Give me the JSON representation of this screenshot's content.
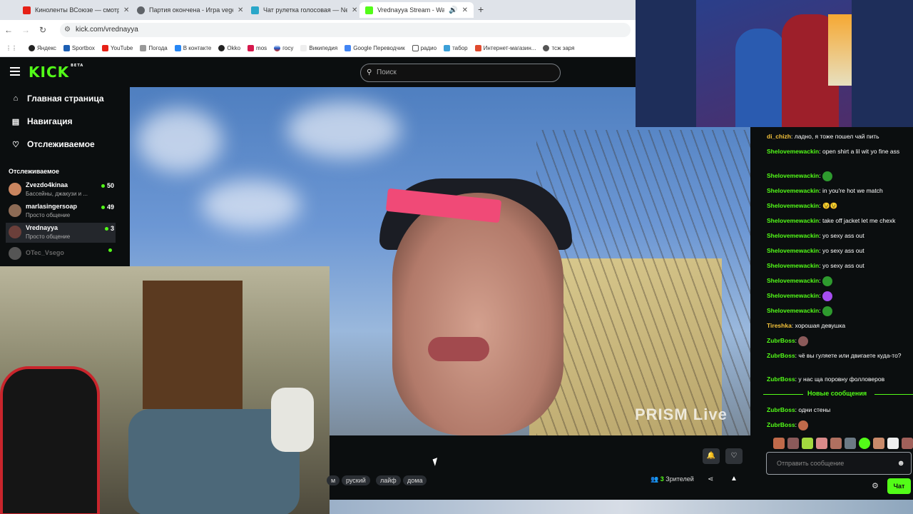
{
  "browser": {
    "tabs": [
      {
        "title": "Киноленты ВСоюзе — смотре",
        "favicon_color": "#e62117"
      },
      {
        "title": "Партия окончена - Игра vege",
        "favicon_color": "#5f6368"
      },
      {
        "title": "Чат рулетка голосовая — Neko",
        "favicon_color": "#2aa7c9"
      },
      {
        "title": "Vrednayya Stream - Watch",
        "favicon_color": "#53fc18"
      }
    ],
    "url": "kick.com/vrednayya",
    "bookmarks": [
      "Яндекс",
      "Sportbox",
      "YouTube",
      "Погода",
      "В контакте",
      "Okko",
      "mos",
      "госу",
      "Википедия",
      "Google Переводчик",
      "радио",
      "табор",
      "Интернет-магазин...",
      "тсж заря"
    ]
  },
  "kick": {
    "logo": "KICK",
    "logo_sup": "BETA",
    "search_placeholder": "Поиск",
    "nav": [
      "Главная страница",
      "Навигация",
      "Отслеживаемое"
    ],
    "following_title": "Отслеживаемое",
    "channels": [
      {
        "name": "Zvezdo4kinaa",
        "category": "Бассейны, джакузи и ...",
        "viewers": "50",
        "avatar_color": "#c9855f"
      },
      {
        "name": "marlasingersoap",
        "category": "Просто общение",
        "viewers": "49",
        "avatar_color": "#8d6b55"
      },
      {
        "name": "Vrednayya",
        "category": "Просто общение",
        "viewers": "3",
        "avatar_color": "#6b3f3a"
      },
      {
        "name": "OTec_Vsego",
        "category": "",
        "viewers": "",
        "avatar_color": "#555555"
      }
    ]
  },
  "stream": {
    "watermark": "PRISM Live",
    "tags": [
      "м",
      "руский",
      "лайф",
      "дома"
    ],
    "viewers_count": "3",
    "viewers_label": "Зрителей"
  },
  "chat": {
    "messages": [
      {
        "user": "di_chizh",
        "color": "#f5c33b",
        "text": "ладно, я тоже пошел чай пить"
      },
      {
        "user": "Shelovemewackin",
        "color": "#53fc18",
        "text": "open shirt a lil wit yo fine ass"
      },
      {
        "user": "Shelovemewackin",
        "color": "#53fc18",
        "text": "",
        "emote": "#2e9a2e"
      },
      {
        "user": "Shelovemewackin",
        "color": "#53fc18",
        "text": "in you're hot we match"
      },
      {
        "user": "Shelovemewackin",
        "color": "#53fc18",
        "text": "😉😉"
      },
      {
        "user": "Shelovemewackin",
        "color": "#53fc18",
        "text": "take off jacket let me chexk"
      },
      {
        "user": "Shelovemewackin",
        "color": "#53fc18",
        "text": "yo sexy ass out"
      },
      {
        "user": "Shelovemewackin",
        "color": "#53fc18",
        "text": "yo sexy ass out"
      },
      {
        "user": "Shelovemewackin",
        "color": "#53fc18",
        "text": "yo sexy ass out"
      },
      {
        "user": "Shelovemewackin",
        "color": "#53fc18",
        "text": "",
        "emote": "#2e9a2e"
      },
      {
        "user": "Shelovemewackin",
        "color": "#53fc18",
        "text": "",
        "emote": "#a64df0"
      },
      {
        "user": "Shelovemewackin",
        "color": "#53fc18",
        "text": "",
        "emote": "#2e9a2e"
      },
      {
        "user": "Tireshka",
        "color": "#f5c33b",
        "text": "хорошая девушка"
      },
      {
        "user": "ZubrBoss",
        "color": "#53fc18",
        "text": "",
        "emote": "#8b5a5a"
      },
      {
        "user": "ZubrBoss",
        "color": "#53fc18",
        "text": "чё вы гуляете или двигаете куда-то?"
      },
      {
        "user": "ZubrBoss",
        "color": "#53fc18",
        "text": "у нас ща поровну фолловеров"
      },
      {
        "user": "ZubrBoss",
        "color": "#53fc18",
        "text": "одни стены"
      },
      {
        "user": "ZubrBoss",
        "color": "#53fc18",
        "text": "",
        "emote": "#c06a4a"
      }
    ],
    "new_messages_label": "Новые сообщения",
    "input_placeholder": "Отправить сообщение",
    "send_label": "Чат"
  },
  "icons": [
    "menu-icon",
    "home-icon",
    "navigation-icon",
    "heart-icon",
    "search-icon",
    "bell-icon",
    "heart-outline-icon",
    "viewers-icon",
    "share-icon",
    "warning-icon",
    "smile-icon",
    "gear-icon"
  ]
}
